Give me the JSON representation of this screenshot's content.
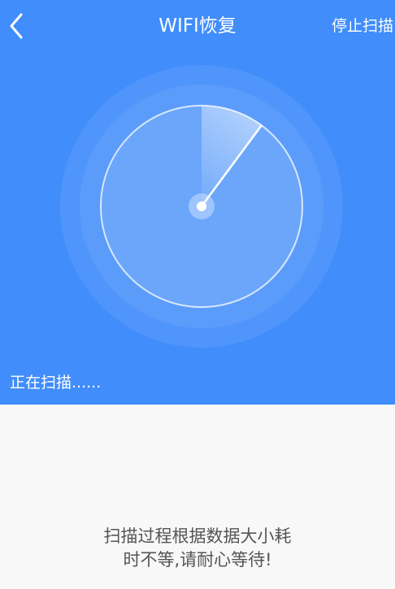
{
  "header": {
    "title": "WIFI恢复",
    "back_icon": "chevron-left-icon",
    "stop_label": "停止扫描",
    "background_color": "#418dfb"
  },
  "scan": {
    "status": "正在扫描......",
    "hint_line1": "扫描过程根据数据大小耗",
    "hint_line2": "时不等,请耐心等待!"
  }
}
